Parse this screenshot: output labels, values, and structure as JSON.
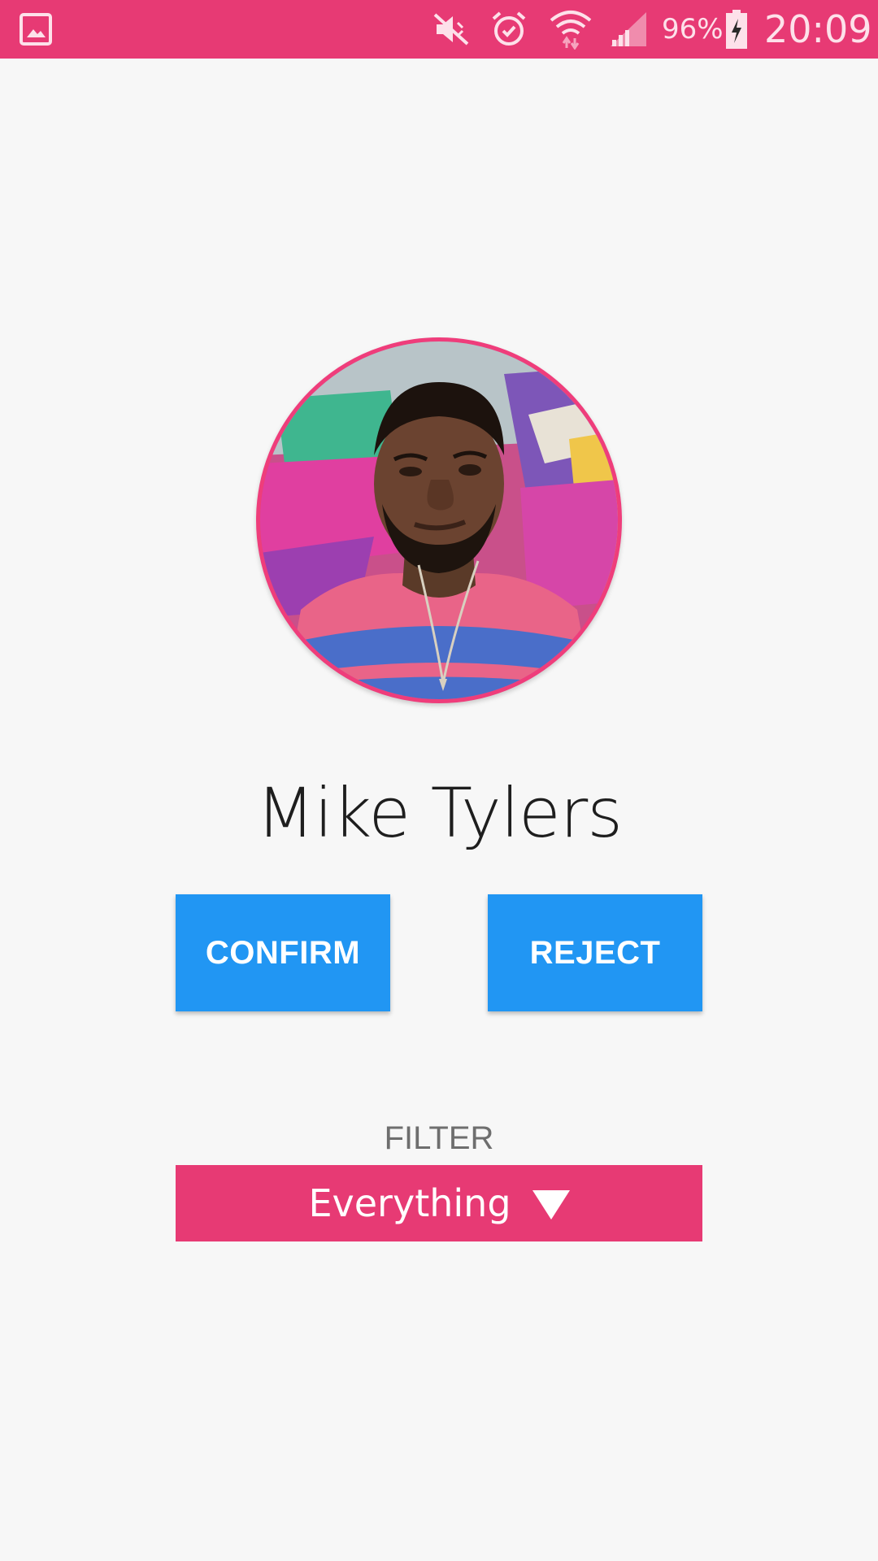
{
  "status_bar": {
    "battery_percent": "96%",
    "time": "20:09",
    "background_color": "#e73a74",
    "icons": [
      "gallery-notification-icon",
      "vibrate-mute-icon",
      "alarm-icon",
      "wifi-icon",
      "cell-signal-icon",
      "battery-charging-icon"
    ]
  },
  "profile": {
    "name": "Mike Tylers",
    "ring_color": "#ef3d7b"
  },
  "actions": {
    "confirm_label": "CONFIRM",
    "reject_label": "REJECT",
    "button_color": "#2196f3"
  },
  "filter": {
    "label": "FILTER",
    "selected": "Everything",
    "accent_color": "#e73a74"
  }
}
